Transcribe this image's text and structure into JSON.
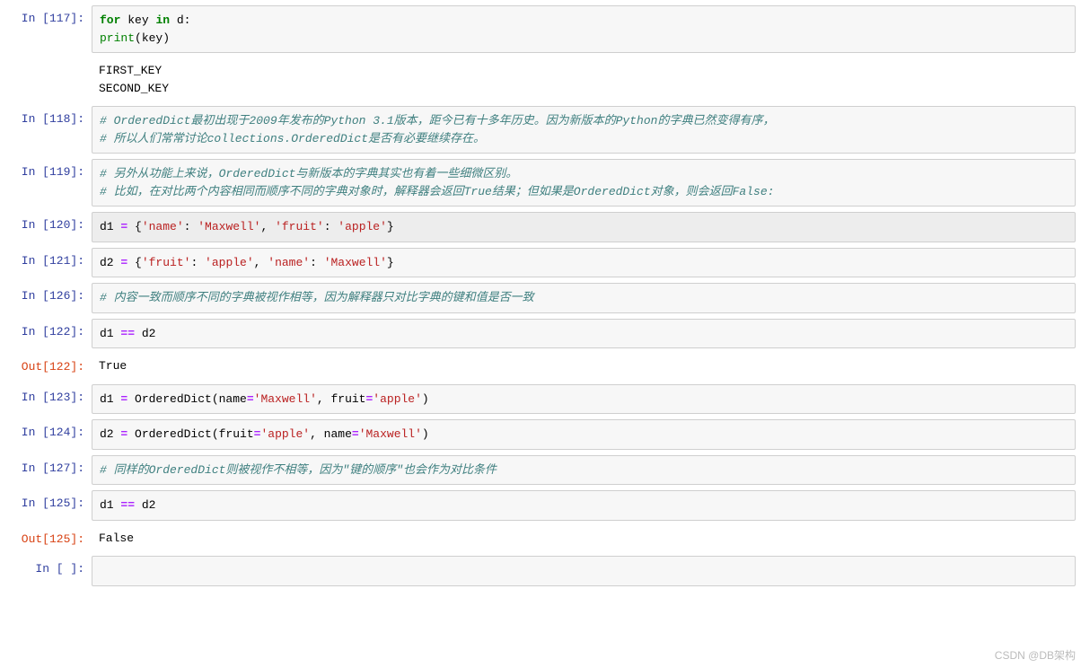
{
  "watermark": "CSDN @DB架构",
  "cells": [
    {
      "num": 117,
      "inputTokens": [
        [
          "kw",
          "for"
        ],
        [
          "",
          null,
          " "
        ],
        [
          "",
          "key"
        ],
        [
          "",
          null,
          " "
        ],
        [
          "kw",
          "in"
        ],
        [
          "",
          null,
          " "
        ],
        [
          "",
          "d:"
        ],
        [
          "br"
        ],
        [
          "",
          null,
          "    "
        ],
        [
          "builtin",
          "print"
        ],
        [
          "",
          "(key)"
        ]
      ],
      "output": "FIRST_KEY\nSECOND_KEY"
    },
    {
      "num": 118,
      "inputTokens": [
        [
          "cmt",
          "# OrderedDict最初出现于2009年发布的Python 3.1版本，距今已有十多年历史。因为新版本的Python的字典已然变得有序，"
        ],
        [
          "br"
        ],
        [
          "cmt",
          "# 所以人们常常讨论collections.OrderedDict是否有必要继续存在。"
        ]
      ]
    },
    {
      "num": 119,
      "inputTokens": [
        [
          "cmt",
          "# 另外从功能上来说，OrderedDict与新版本的字典其实也有着一些细微区别。"
        ],
        [
          "br"
        ],
        [
          "cmt",
          "# 比如，在对比两个内容相同而顺序不同的字典对象时，解释器会返回True结果；但如果是OrderedDict对象，则会返回False:"
        ]
      ]
    },
    {
      "num": 120,
      "selected": true,
      "inputTokens": [
        [
          "",
          "d1 "
        ],
        [
          "op",
          "="
        ],
        [
          "",
          " {"
        ],
        [
          "str",
          "'name'"
        ],
        [
          "",
          ": "
        ],
        [
          "str",
          "'Maxwell'"
        ],
        [
          "",
          ", "
        ],
        [
          "str",
          "'fruit'"
        ],
        [
          "",
          ": "
        ],
        [
          "str",
          "'apple'"
        ],
        [
          "",
          "}"
        ]
      ]
    },
    {
      "num": 121,
      "inputTokens": [
        [
          "",
          "d2 "
        ],
        [
          "op",
          "="
        ],
        [
          "",
          " {"
        ],
        [
          "str",
          "'fruit'"
        ],
        [
          "",
          ": "
        ],
        [
          "str",
          "'apple'"
        ],
        [
          "",
          ", "
        ],
        [
          "str",
          "'name'"
        ],
        [
          "",
          ": "
        ],
        [
          "str",
          "'Maxwell'"
        ],
        [
          "",
          "}"
        ]
      ]
    },
    {
      "num": 126,
      "inputTokens": [
        [
          "cmt",
          "# 内容一致而顺序不同的字典被视作相等，因为解释器只对比字典的键和值是否一致"
        ]
      ]
    },
    {
      "num": 122,
      "inputTokens": [
        [
          "",
          "d1 "
        ],
        [
          "op",
          "=="
        ],
        [
          "",
          " d2"
        ]
      ],
      "result": "True",
      "resultNum": 122
    },
    {
      "num": 123,
      "inputTokens": [
        [
          "",
          "d1 "
        ],
        [
          "op",
          "="
        ],
        [
          "",
          " OrderedDict(name"
        ],
        [
          "op",
          "="
        ],
        [
          "str",
          "'Maxwell'"
        ],
        [
          "",
          ", fruit"
        ],
        [
          "op",
          "="
        ],
        [
          "str",
          "'apple'"
        ],
        [
          "",
          ")"
        ]
      ]
    },
    {
      "num": 124,
      "inputTokens": [
        [
          "",
          "d2 "
        ],
        [
          "op",
          "="
        ],
        [
          "",
          " OrderedDict(fruit"
        ],
        [
          "op",
          "="
        ],
        [
          "str",
          "'apple'"
        ],
        [
          "",
          ", name"
        ],
        [
          "op",
          "="
        ],
        [
          "str",
          "'Maxwell'"
        ],
        [
          "",
          ")"
        ]
      ]
    },
    {
      "num": 127,
      "inputTokens": [
        [
          "cmt",
          "# 同样的OrderedDict则被视作不相等，因为\"键的顺序\"也会作为对比条件"
        ]
      ]
    },
    {
      "num": 125,
      "inputTokens": [
        [
          "",
          "d1 "
        ],
        [
          "op",
          "=="
        ],
        [
          "",
          " d2"
        ]
      ],
      "result": "False",
      "resultNum": 125
    },
    {
      "num": null,
      "empty": true
    }
  ]
}
